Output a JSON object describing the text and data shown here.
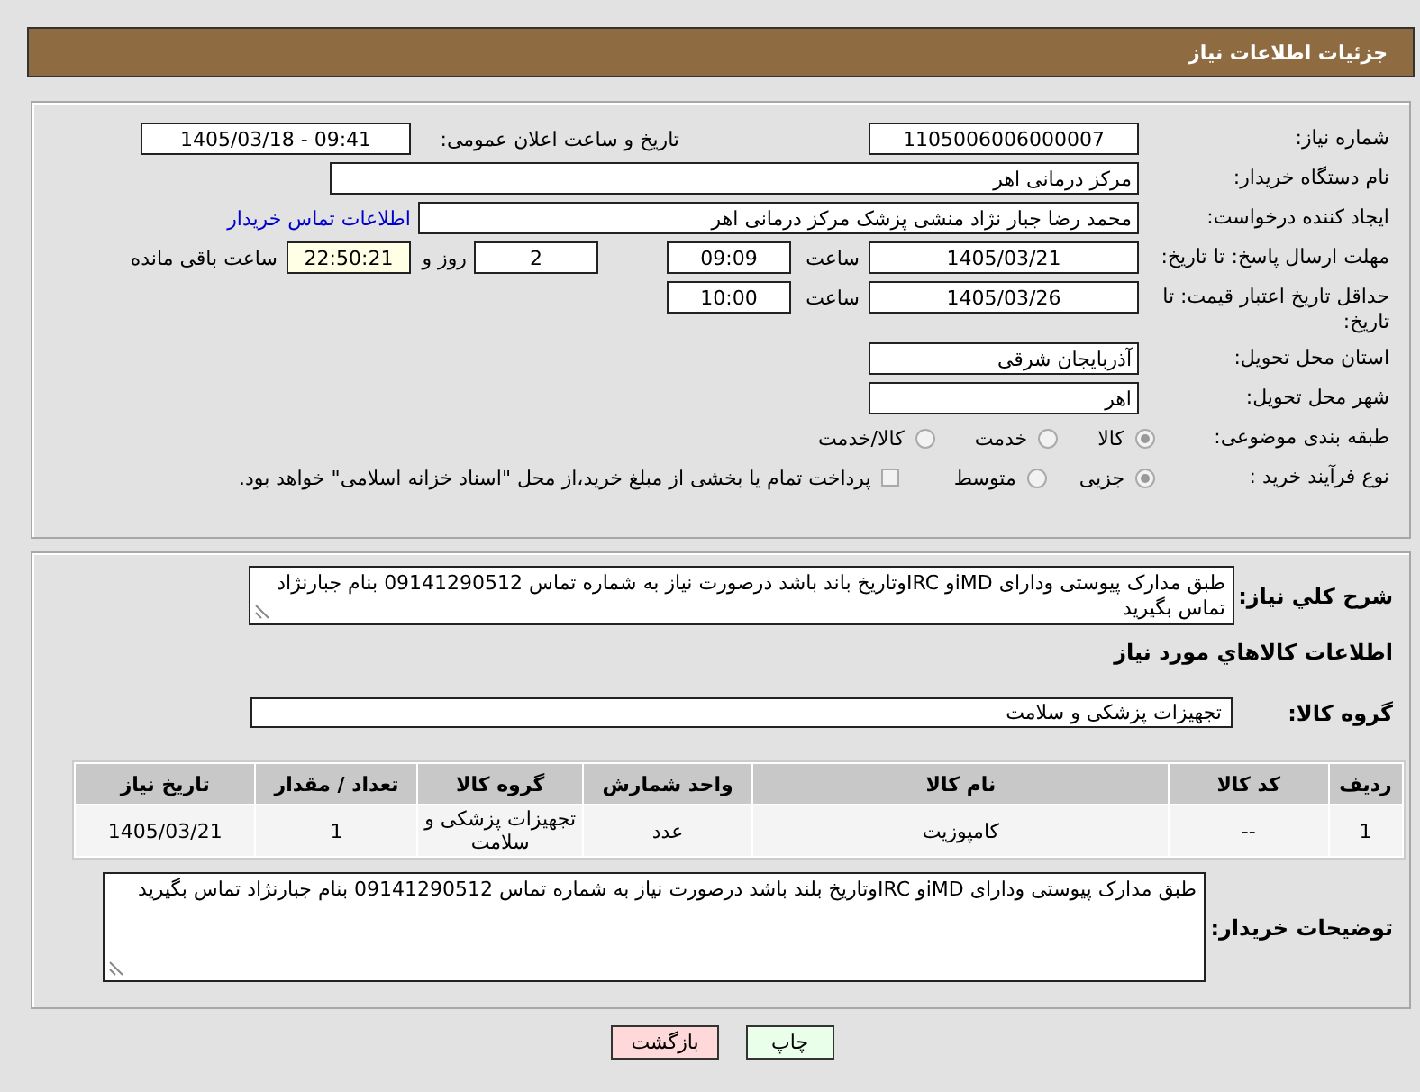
{
  "header": {
    "title": "جزئیات اطلاعات نیاز"
  },
  "form_rows": [
    {
      "label": "شماره نیاز:",
      "items": [
        {
          "kind": "field",
          "value": "1105006006000007"
        },
        {
          "kind": "text",
          "text": "تاریخ و ساعت اعلان عمومی:"
        },
        {
          "kind": "field",
          "value": "1405/03/18 - 09:41"
        }
      ]
    },
    {
      "label": "نام دستگاه خریدار:",
      "items": [
        {
          "kind": "name-field",
          "value": "مرکز درمانی اهر"
        }
      ]
    },
    {
      "label": "ایجاد کننده درخواست:",
      "items": [
        {
          "kind": "name-field",
          "value": "محمد رضا  جبار نژاد منشی پزشک  مرکز درمانی اهر"
        },
        {
          "kind": "link",
          "text": "اطلاعات تماس خریدار"
        }
      ]
    },
    {
      "label": "مهلت ارسال پاسخ: تا تاریخ:",
      "items": [
        {
          "kind": "field",
          "value": "1405/03/21"
        },
        {
          "kind": "text",
          "text": "ساعت"
        },
        {
          "kind": "field",
          "value": "09:09"
        },
        {
          "kind": "field",
          "value": "2"
        },
        {
          "kind": "text",
          "text": "روز و"
        },
        {
          "kind": "timer",
          "value": "22:50:21"
        },
        {
          "kind": "text",
          "text": "ساعت باقی مانده"
        }
      ]
    },
    {
      "label": "حداقل تاریخ اعتبار قیمت: تا تاریخ:",
      "items": [
        {
          "kind": "field",
          "value": "1405/03/26"
        },
        {
          "kind": "text",
          "text": "ساعت"
        },
        {
          "kind": "field",
          "value": "10:00"
        }
      ]
    },
    {
      "label": "استان محل تحویل:",
      "items": [
        {
          "kind": "name-field",
          "value": "آذربایجان شرقی"
        }
      ]
    },
    {
      "label": "شهر محل تحویل:",
      "items": [
        {
          "kind": "name-field",
          "value": "اهر"
        }
      ]
    },
    {
      "label": "طبقه بندی موضوعی:",
      "items": [
        {
          "kind": "radio",
          "text": "کالا",
          "selected": true
        },
        {
          "kind": "radio",
          "text": "خدمت",
          "selected": false
        },
        {
          "kind": "radio",
          "text": "کالا/خدمت",
          "selected": false
        }
      ]
    },
    {
      "label": "نوع فرآیند خرید :",
      "items": [
        {
          "kind": "radio",
          "text": "جزیی",
          "selected": true
        },
        {
          "kind": "radio",
          "text": "متوسط",
          "selected": false
        },
        {
          "kind": "checkbox",
          "text": "پرداخت تمام یا بخشی از مبلغ خرید،از محل \"اسناد خزانه اسلامی\" خواهد بود.",
          "checked": false
        }
      ]
    }
  ],
  "goods": {
    "description": {
      "label": "شرح کلي نياز:",
      "value": "طبق مدارک پیوستی ودارای iMDو  IRCوتاریخ باند باشد درصورت نیاز به شماره تماس 09141290512 بنام جبارنژاد تماس بگیرید"
    },
    "heading": "اطلاعات کالاهاي مورد نياز",
    "group": {
      "label": "گروه کالا:",
      "value": "تجهیزات پزشکی و سلامت"
    },
    "table": {
      "columns": [
        "ردیف",
        "کد کالا",
        "نام کالا",
        "واحد شمارش",
        "گروه کالا",
        "تعداد / مقدار",
        "تاریخ نیاز"
      ],
      "rows": [
        [
          "1",
          "--",
          "کامپوزیت",
          "عدد",
          "تجهیزات پزشکی و سلامت",
          "1",
          "1405/03/21"
        ]
      ]
    },
    "buyer_notes": {
      "label": "توضیحات خریدار:",
      "value": "طبق مدارک پیوستی ودارای iMDو  IRCوتاریخ بلند باشد درصورت نیاز به شماره تماس 09141290512 بنام جبارنژاد تماس بگیرید"
    }
  },
  "buttons": [
    {
      "kind": "print",
      "label": "چاپ"
    },
    {
      "kind": "back",
      "label": "بازگشت"
    }
  ]
}
